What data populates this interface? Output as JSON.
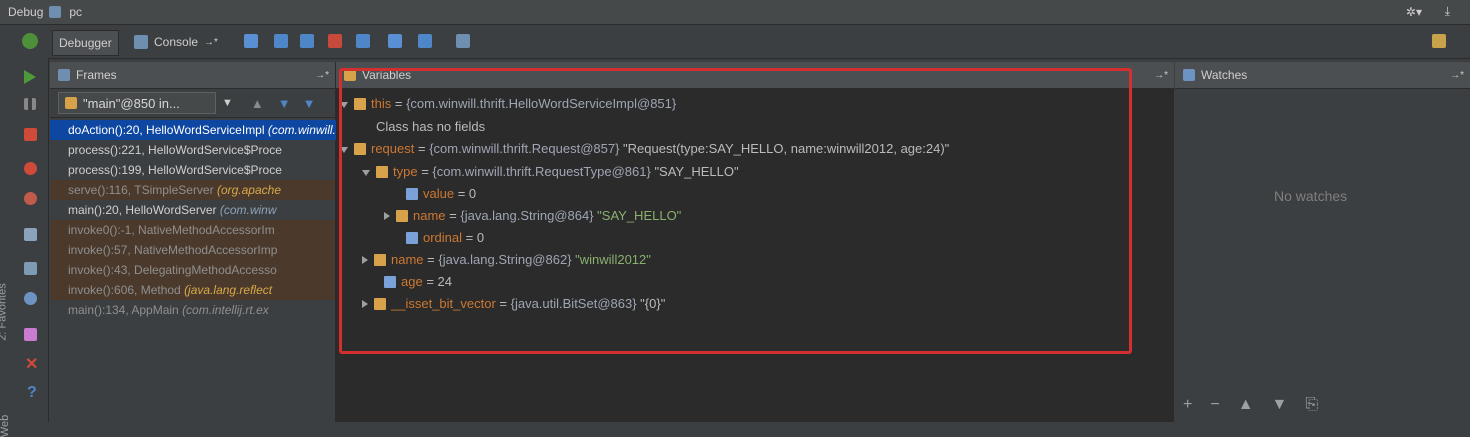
{
  "window": {
    "title": "Debug",
    "config": "pc"
  },
  "toolbar": {
    "tabs": {
      "debugger": "Debugger",
      "console": "Console"
    }
  },
  "frames": {
    "header": "Frames",
    "thread": "\"main\"@850 in...",
    "items": [
      {
        "method": "doAction():20, HelloWordServiceImpl ",
        "location": "(com.winwill.thrift)",
        "selected": true,
        "dim": false
      },
      {
        "method": "process():221, HelloWordService$Proce",
        "location": "",
        "selected": false,
        "dim": false
      },
      {
        "method": "process():199, HelloWordService$Proce",
        "location": "",
        "selected": false,
        "dim": false
      },
      {
        "method": "serve():116, TSimpleServer ",
        "location": "(org.apache",
        "selected": false,
        "dim": true
      },
      {
        "method": "main():20, HelloWordServer ",
        "location": "(com.winw",
        "selected": false,
        "dim": false
      },
      {
        "method": "invoke0():-1, NativeMethodAccessorIm",
        "location": "",
        "selected": false,
        "dim": true
      },
      {
        "method": "invoke():57, NativeMethodAccessorImp",
        "location": "",
        "selected": false,
        "dim": true
      },
      {
        "method": "invoke():43, DelegatingMethodAccesso",
        "location": "",
        "selected": false,
        "dim": true
      },
      {
        "method": "invoke():606, Method ",
        "location": "(java.lang.reflect",
        "selected": false,
        "dim": true
      },
      {
        "method": "main():134, AppMain ",
        "location": "(com.intellij.rt.ex",
        "selected": false,
        "dim": true
      }
    ]
  },
  "variables": {
    "header": "Variables",
    "rows": [
      {
        "name": "this",
        "value": "{com.winwill.thrift.HelloWordServiceImpl@851}",
        "extra": ""
      },
      {
        "name": "Class has no fields",
        "value": "",
        "extra": ""
      },
      {
        "name": "request",
        "value": "{com.winwill.thrift.Request@857}",
        "extra": " \"Request(type:SAY_HELLO, name:winwill2012, age:24)\""
      },
      {
        "name": "type",
        "value": "{com.winwill.thrift.RequestType@861}",
        "extra": " \"SAY_HELLO\""
      },
      {
        "name": "value",
        "value": "0",
        "extra": ""
      },
      {
        "name": "name",
        "value": "{java.lang.String@864}",
        "extra": " \"SAY_HELLO\""
      },
      {
        "name": "ordinal",
        "value": "0",
        "extra": ""
      },
      {
        "name": "name",
        "value": "{java.lang.String@862}",
        "extra": " \"winwill2012\""
      },
      {
        "name": "age",
        "value": "24",
        "extra": ""
      },
      {
        "name": "__isset_bit_vector",
        "value": "{java.util.BitSet@863}",
        "extra": " \"{0}\""
      }
    ]
  },
  "watches": {
    "header": "Watches",
    "empty": "No watches"
  },
  "sidebar": {
    "favorites": "2: Favorites",
    "web": "Web"
  }
}
